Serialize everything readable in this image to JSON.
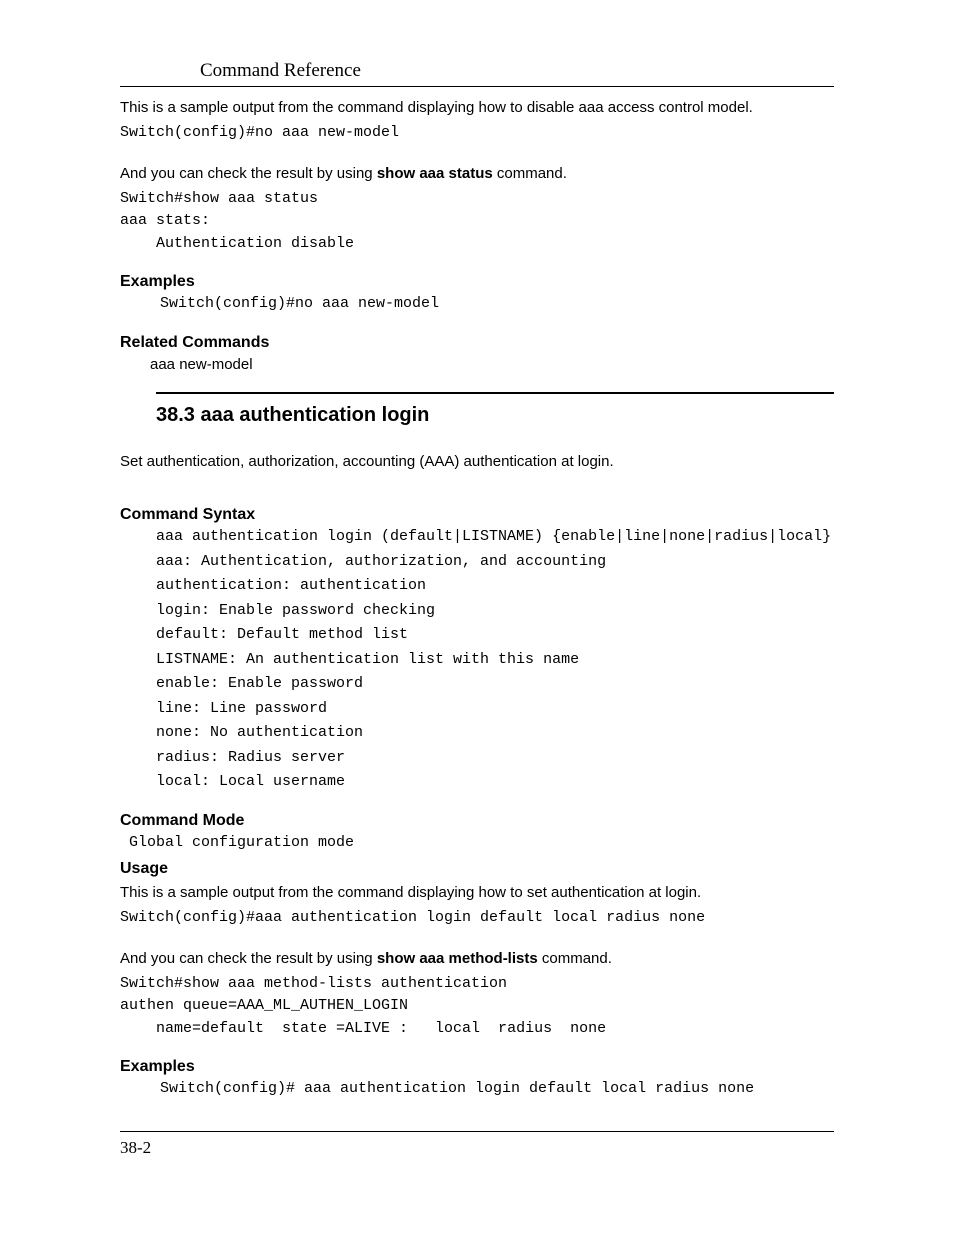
{
  "header": {
    "running": "Command Reference"
  },
  "intro": {
    "line1": "This is a sample output from the command displaying how to disable aaa access control model.",
    "code1": "Switch(config)#no aaa new-model",
    "line2a": "And you can check the result by using ",
    "line2bold": "show aaa status",
    "line2b": " command.",
    "codeblock": "Switch#show aaa status\naaa stats:\n    Authentication disable"
  },
  "examples1": {
    "title": "Examples",
    "code": "Switch(config)#no aaa new-model"
  },
  "related": {
    "title": "Related Commands",
    "item": "aaa new-model"
  },
  "section": {
    "title": "38.3 aaa authentication login"
  },
  "desc": "Set authentication, authorization, accounting (AAA) authentication at login.",
  "syntax": {
    "title": "Command Syntax",
    "line": "aaa authentication login (default|LISTNAME) {enable|line|none|radius|local}",
    "defs": [
      "aaa: Authentication, authorization, and accounting",
      "authentication: authentication",
      "login: Enable password checking",
      "default: Default method list",
      "LISTNAME: An authentication list with this name",
      "enable: Enable password",
      "line: Line password",
      "none: No authentication",
      "radius: Radius server",
      "local: Local username"
    ]
  },
  "mode": {
    "title": "Command Mode",
    "text": " Global configuration mode"
  },
  "usage": {
    "title": "Usage",
    "line1": "This is a sample output from the command displaying how to set authentication at login.",
    "code1": "Switch(config)#aaa authentication login default local radius none",
    "line2a": "And you can check the result by using ",
    "line2bold": "show aaa method-lists",
    "line2b": " command.",
    "codeblock": "Switch#show aaa method-lists authentication\nauthen queue=AAA_ML_AUTHEN_LOGIN\n    name=default  state =ALIVE :   local  radius  none"
  },
  "examples2": {
    "title": "Examples",
    "code": "Switch(config)# aaa authentication login default local radius none"
  },
  "footer": {
    "pagenum": "38-2"
  }
}
